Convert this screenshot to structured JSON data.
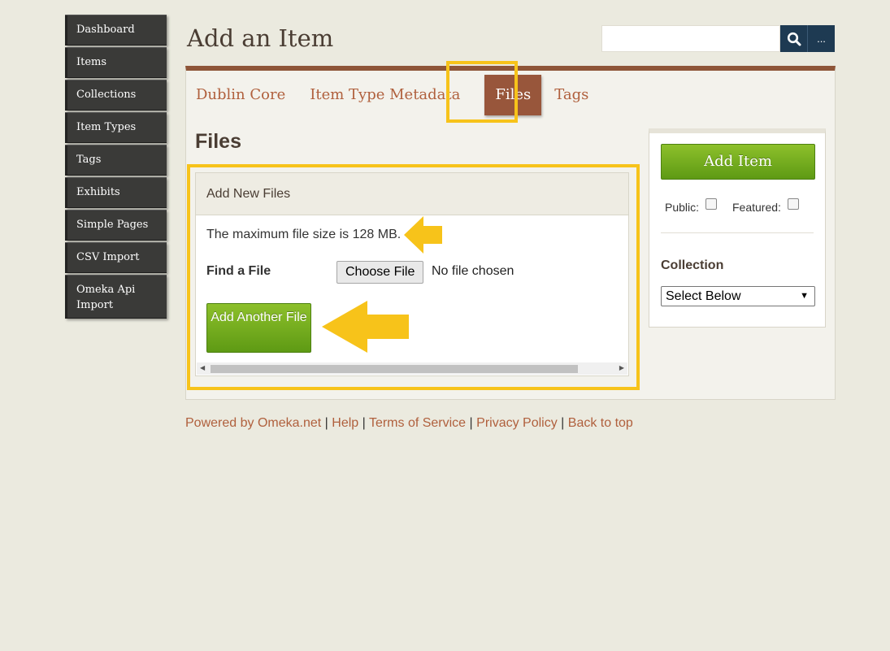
{
  "sidebar": {
    "items": [
      {
        "label": "Dashboard"
      },
      {
        "label": "Items"
      },
      {
        "label": "Collections"
      },
      {
        "label": "Item Types"
      },
      {
        "label": "Tags"
      },
      {
        "label": "Exhibits"
      },
      {
        "label": "Simple Pages"
      },
      {
        "label": "CSV Import"
      },
      {
        "label": "Omeka Api Import"
      }
    ]
  },
  "header": {
    "title": "Add an Item",
    "search_placeholder": "",
    "more_label": "..."
  },
  "tabs": [
    {
      "label": "Dublin Core",
      "active": false
    },
    {
      "label": "Item Type Metadata",
      "active": false
    },
    {
      "label": "Files",
      "active": true
    },
    {
      "label": "Tags",
      "active": false
    }
  ],
  "main": {
    "section_title": "Files",
    "add_new_files_heading": "Add New Files",
    "max_file_size_text": "The maximum file size is 128 MB.",
    "find_file_label": "Find a File",
    "choose_file_label": "Choose File",
    "no_file_text": "No file chosen",
    "add_another_label": "Add Another File"
  },
  "save_panel": {
    "add_item_label": "Add Item",
    "public_label": "Public:",
    "featured_label": "Featured:",
    "collection_label": "Collection",
    "collection_selected": "Select Below"
  },
  "footer": {
    "powered_by": "Powered by Omeka.net",
    "help": "Help",
    "terms": "Terms of Service",
    "privacy": "Privacy Policy",
    "back_to_top": "Back to top",
    "separator": "|"
  },
  "colors": {
    "accent": "#98563b",
    "link": "#b0603d",
    "highlight": "#f7c31a",
    "button_green": "#6fa81c",
    "search_blue": "#1e3a52"
  }
}
